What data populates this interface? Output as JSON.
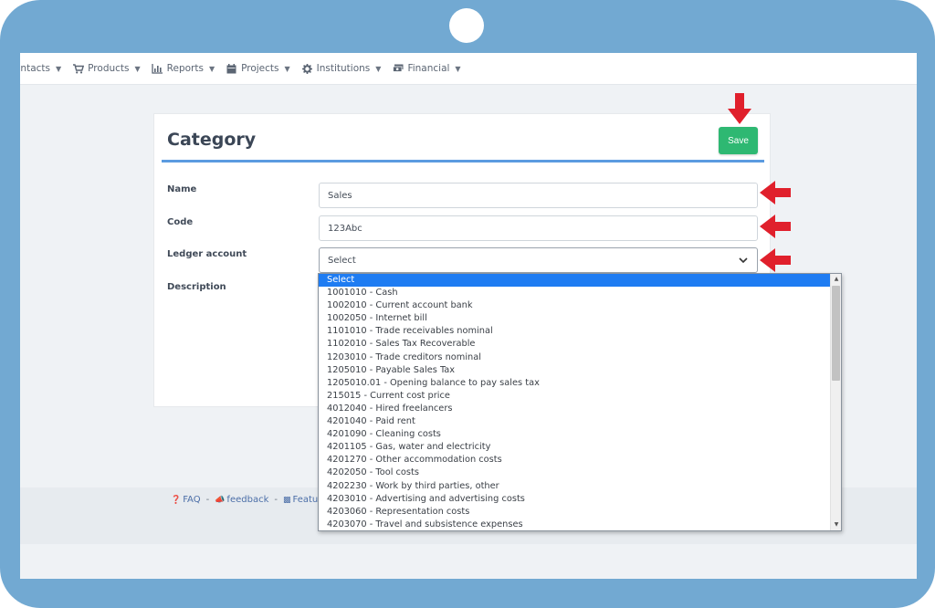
{
  "nav": {
    "items": [
      {
        "label": "ontacts",
        "icon": "contacts-icon"
      },
      {
        "label": "Products",
        "icon": "cart-icon"
      },
      {
        "label": "Reports",
        "icon": "bar-chart-icon"
      },
      {
        "label": "Projects",
        "icon": "calendar-icon"
      },
      {
        "label": "Institutions",
        "icon": "gear-icon"
      },
      {
        "label": "Financial",
        "icon": "money-icon"
      }
    ]
  },
  "form": {
    "title": "Category",
    "save_label": "Save",
    "name_label": "Name",
    "name_value": "Sales",
    "code_label": "Code",
    "code_value": "123Abc",
    "ledger_label": "Ledger account",
    "ledger_value": "Select",
    "description_label": "Description"
  },
  "dropdown": {
    "options": [
      "Select",
      "1001010 - Cash",
      "1002010 - Current account bank",
      "1002050 - Internet bill",
      "1101010 - Trade receivables nominal",
      "1102010 - Sales Tax Recoverable",
      "1203010 - Trade creditors nominal",
      "1205010 - Payable Sales Tax",
      "1205010.01 - Opening balance to pay sales tax",
      "215015 - Current cost price",
      "4012040 - Hired freelancers",
      "4201040 - Paid rent",
      "4201090 - Cleaning costs",
      "4201105 - Gas, water and electricity",
      "4201270 - Other accommodation costs",
      "4202050 - Tool costs",
      "4202230 - Work by third parties, other",
      "4203010 - Advertising and advertising costs",
      "4203060 - Representation costs",
      "4203070 - Travel and subsistence expenses"
    ]
  },
  "footer": {
    "faq": "FAQ",
    "feedback": "feedback",
    "feature": "Feature"
  },
  "colors": {
    "frame": "#72a9d2",
    "accent": "#5b9be0",
    "save": "#2eb872",
    "arrow": "#e0202c",
    "selected_option": "#1e7cf2"
  }
}
